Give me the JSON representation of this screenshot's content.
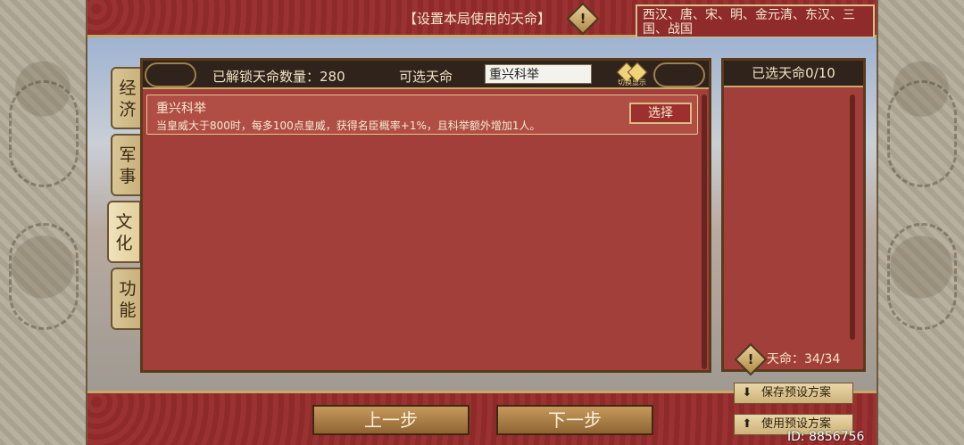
{
  "top": {
    "title": "【设置本局使用的天命】",
    "dynasties": "西汉、唐、宋、明、金元清、东汉、三国、战国"
  },
  "tabs": [
    {
      "label": "经济"
    },
    {
      "label": "军事"
    },
    {
      "label": "文化"
    },
    {
      "label": "功能"
    }
  ],
  "active_tab": "文化",
  "main": {
    "unlocked_label": "已解锁天命数量：280",
    "selectable_label": "可选天命",
    "search_value": "重兴科举",
    "switch_icon_text": "切换显示",
    "mandates": [
      {
        "name": "重兴科举",
        "description": "当皇威大于800时，每多100点皇威，获得名臣概率+1%，且科举额外增加1人。",
        "button": "选择"
      }
    ]
  },
  "right": {
    "header": "已选天命0/10",
    "count": "天命：34/34"
  },
  "bottom": {
    "prev": "上一步",
    "next": "下一步",
    "save_preset": "保存预设方案",
    "use_preset": "使用预设方案",
    "id_text": "ID: 8856756"
  },
  "colors": {
    "panel_red": "#a23f3a",
    "header_dark": "#2f231b",
    "gold_border": "#c9a96a"
  }
}
